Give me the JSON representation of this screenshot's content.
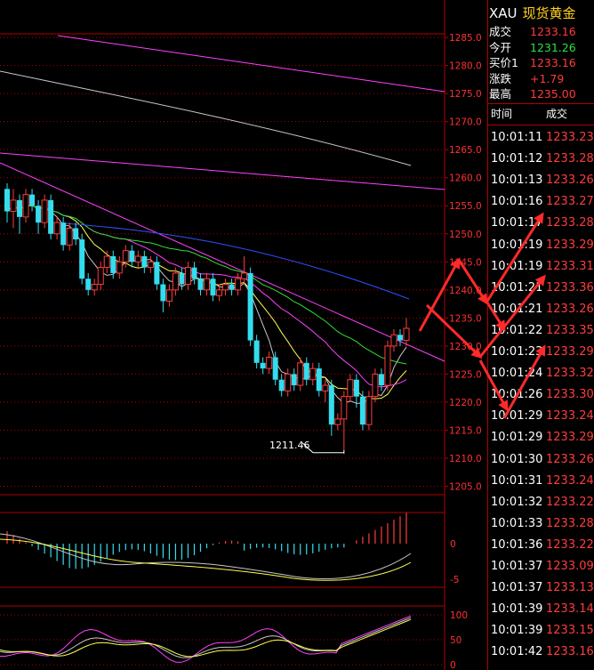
{
  "header": {
    "symbol": "XAU",
    "name": "现货黄金"
  },
  "quote": [
    {
      "label": "成交",
      "value": "1233.16",
      "color": "red"
    },
    {
      "label": "今开",
      "value": "1231.26",
      "color": "green"
    },
    {
      "label": "买价1",
      "value": "1233.16",
      "color": "red"
    },
    {
      "label": "涨跌",
      "value": "+1.79",
      "color": "red"
    },
    {
      "label": "最高",
      "value": "1235.00",
      "color": "red"
    }
  ],
  "ticks_header": {
    "time": "时间",
    "price": "成交"
  },
  "ticks": [
    {
      "time": "10:01:11",
      "price": "1233.23"
    },
    {
      "time": "10:01:12",
      "price": "1233.28"
    },
    {
      "time": "10:01:13",
      "price": "1233.26"
    },
    {
      "time": "10:01:16",
      "price": "1233.27"
    },
    {
      "time": "10:01:17",
      "price": "1233.28"
    },
    {
      "time": "10:01:19",
      "price": "1233.29"
    },
    {
      "time": "10:01:19",
      "price": "1233.31"
    },
    {
      "time": "10:01:21",
      "price": "1233.36"
    },
    {
      "time": "10:01:21",
      "price": "1233.26"
    },
    {
      "time": "10:01:22",
      "price": "1233.35"
    },
    {
      "time": "10:01:23",
      "price": "1233.29"
    },
    {
      "time": "10:01:24",
      "price": "1233.32"
    },
    {
      "time": "10:01:26",
      "price": "1233.30"
    },
    {
      "time": "10:01:29",
      "price": "1233.24"
    },
    {
      "time": "10:01:29",
      "price": "1233.29"
    },
    {
      "time": "10:01:30",
      "price": "1233.26"
    },
    {
      "time": "10:01:31",
      "price": "1233.24"
    },
    {
      "time": "10:01:32",
      "price": "1233.22"
    },
    {
      "time": "10:01:33",
      "price": "1233.28"
    },
    {
      "time": "10:01:36",
      "price": "1233.22"
    },
    {
      "time": "10:01:37",
      "price": "1233.09"
    },
    {
      "time": "10:01:37",
      "price": "1233.13"
    },
    {
      "time": "10:01:39",
      "price": "1233.14"
    },
    {
      "time": "10:01:39",
      "price": "1233.15"
    },
    {
      "time": "10:01:42",
      "price": "1233.16"
    }
  ],
  "chart_data": {
    "type": "candlestick",
    "price_axis": [
      1285,
      1280,
      1275,
      1270,
      1265,
      1260,
      1255,
      1250,
      1245,
      1240,
      1235,
      1230,
      1225,
      1220,
      1215,
      1210,
      1205
    ],
    "price_axis_labels": [
      "1285.0",
      "1280.0",
      "1275.0",
      "1270.0",
      "1265.0",
      "1260.0",
      "1255.0",
      "1250.0",
      "1245.0",
      "1240.0",
      "1235.0",
      "1230.0",
      "1225.0",
      "1220.0",
      "1215.0",
      "1210.0",
      "1205.0"
    ],
    "ylim": [
      1203.5,
      1288.5
    ],
    "low_annotation": {
      "text": "1211.46",
      "value": 1211.46
    },
    "macd_axis": [
      "0",
      "-5"
    ],
    "kdj_axis": [
      "100",
      "50",
      "0"
    ],
    "candles": [
      [
        1258,
        1254,
        1259,
        1252
      ],
      [
        1254,
        1256,
        1258,
        1251
      ],
      [
        1256,
        1253,
        1257,
        1250
      ],
      [
        1253,
        1257,
        1258,
        1252
      ],
      [
        1257,
        1255,
        1258,
        1254
      ],
      [
        1255,
        1252,
        1256,
        1250
      ],
      [
        1252,
        1256,
        1257,
        1251
      ],
      [
        1256,
        1250,
        1257,
        1249
      ],
      [
        1250,
        1252,
        1253,
        1249
      ],
      [
        1252,
        1248,
        1253,
        1247
      ],
      [
        1248,
        1251,
        1252,
        1247
      ],
      [
        1251,
        1249,
        1252,
        1248
      ],
      [
        1249,
        1242,
        1250,
        1241
      ],
      [
        1242,
        1240,
        1243,
        1239
      ],
      [
        1240,
        1241,
        1242,
        1239
      ],
      [
        1241,
        1244,
        1245,
        1240
      ],
      [
        1244,
        1246,
        1247,
        1243
      ],
      [
        1246,
        1243,
        1247,
        1242
      ],
      [
        1243,
        1245,
        1246,
        1242
      ],
      [
        1245,
        1247,
        1248,
        1244
      ],
      [
        1247,
        1245,
        1248,
        1244
      ],
      [
        1245,
        1246,
        1247,
        1244
      ],
      [
        1246,
        1244,
        1247,
        1243
      ],
      [
        1244,
        1245,
        1246,
        1243
      ],
      [
        1245,
        1241,
        1246,
        1240
      ],
      [
        1241,
        1238,
        1242,
        1236
      ],
      [
        1238,
        1240,
        1241,
        1237
      ],
      [
        1240,
        1243,
        1244,
        1239
      ],
      [
        1243,
        1241,
        1244,
        1240
      ],
      [
        1241,
        1244,
        1245,
        1240
      ],
      [
        1244,
        1242,
        1245,
        1241
      ],
      [
        1242,
        1240,
        1243,
        1239
      ],
      [
        1240,
        1242,
        1243,
        1239
      ],
      [
        1242,
        1239,
        1243,
        1238
      ],
      [
        1239,
        1240,
        1241,
        1238
      ],
      [
        1240,
        1241,
        1242,
        1239
      ],
      [
        1241,
        1240,
        1242,
        1239
      ],
      [
        1240,
        1242,
        1243,
        1239
      ],
      [
        1242,
        1243,
        1246,
        1241
      ],
      [
        1243,
        1231,
        1244,
        1230
      ],
      [
        1231,
        1227,
        1232,
        1226
      ],
      [
        1227,
        1226,
        1228,
        1225
      ],
      [
        1226,
        1228,
        1229,
        1225
      ],
      [
        1228,
        1224,
        1229,
        1223
      ],
      [
        1224,
        1222,
        1225,
        1221
      ],
      [
        1222,
        1225,
        1226,
        1221
      ],
      [
        1225,
        1223,
        1226,
        1222
      ],
      [
        1223,
        1227,
        1228,
        1222
      ],
      [
        1227,
        1224,
        1228,
        1223
      ],
      [
        1224,
        1226,
        1227,
        1223
      ],
      [
        1226,
        1222,
        1227,
        1221
      ],
      [
        1222,
        1223,
        1224,
        1220
      ],
      [
        1223,
        1216,
        1224,
        1214
      ],
      [
        1216,
        1217,
        1218,
        1215
      ],
      [
        1217,
        1221,
        1222,
        1211.46
      ],
      [
        1221,
        1224,
        1225,
        1220
      ],
      [
        1224,
        1221,
        1225,
        1219
      ],
      [
        1221,
        1216,
        1222,
        1215
      ],
      [
        1216,
        1221,
        1222,
        1215
      ],
      [
        1221,
        1225,
        1226,
        1220
      ],
      [
        1225,
        1223,
        1226,
        1222
      ],
      [
        1223,
        1230,
        1231,
        1222
      ],
      [
        1230,
        1232,
        1233,
        1229
      ],
      [
        1232,
        1231,
        1233,
        1230
      ],
      [
        1231,
        1233.16,
        1235,
        1230
      ]
    ]
  },
  "colors": {
    "up": "#ff3c3c",
    "down": "#33ddee",
    "grid": "#b00000",
    "axis_text": "#ff3030",
    "ma_white": "#c8c8c8",
    "ma_yellow": "#ffff50",
    "ma_magenta": "#ff40ff",
    "ma_green": "#30e030",
    "ma_blue": "#3050ff",
    "arrow": "#ff2a2a"
  }
}
